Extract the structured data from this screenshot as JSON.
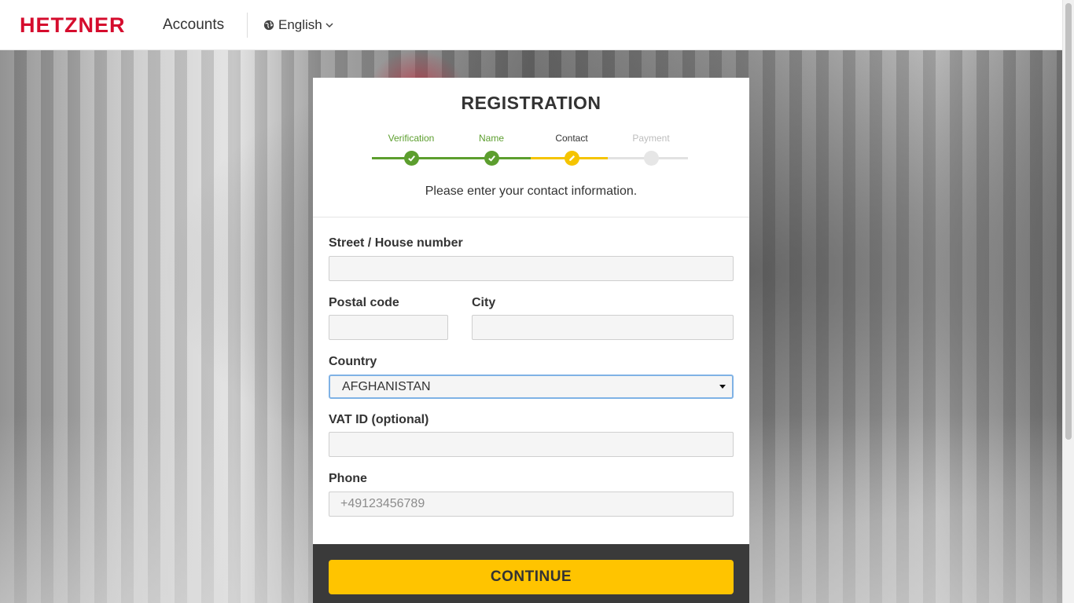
{
  "header": {
    "logo_text": "HETZNER",
    "app_name": "Accounts",
    "language": "English",
    "brand_color": "#d50c2d"
  },
  "card": {
    "title": "REGISTRATION",
    "steps": [
      {
        "label": "Verification",
        "state": "done",
        "icon": "check-icon"
      },
      {
        "label": "Name",
        "state": "done",
        "icon": "check-icon"
      },
      {
        "label": "Contact",
        "state": "current",
        "icon": "pencil-icon"
      },
      {
        "label": "Payment",
        "state": "pending",
        "icon": ""
      }
    ],
    "subtitle": "Please enter your contact information.",
    "colors": {
      "done": "#5c9e2e",
      "current": "#f5c400",
      "pending": "#dcdcdc",
      "accent": "#ffc400"
    }
  },
  "form": {
    "street_label": "Street / House number",
    "street_value": "",
    "postal_label": "Postal code",
    "postal_value": "",
    "city_label": "City",
    "city_value": "",
    "country_label": "Country",
    "country_value": "AFGHANISTAN",
    "vat_label": "VAT ID (optional)",
    "vat_value": "",
    "phone_label": "Phone",
    "phone_placeholder": "+49123456789",
    "phone_value": ""
  },
  "footer": {
    "continue_label": "CONTINUE"
  }
}
